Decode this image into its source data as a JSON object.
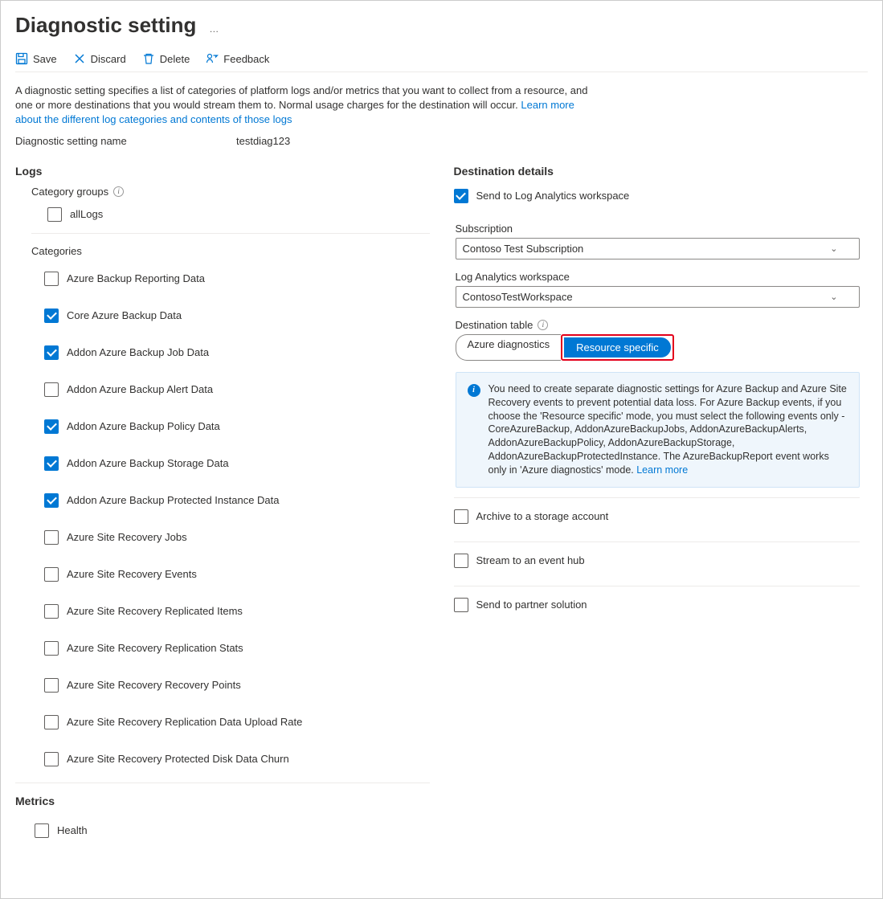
{
  "title": "Diagnostic setting",
  "ellipsis": "…",
  "toolbar": {
    "save": "Save",
    "discard": "Discard",
    "delete": "Delete",
    "feedback": "Feedback"
  },
  "description_1": "A diagnostic setting specifies a list of categories of platform logs and/or metrics that you want to collect from a resource, and one or more destinations that you would stream them to. Normal usage charges for the destination will occur. ",
  "description_link": "Learn more about the different log categories and contents of those logs",
  "name_label": "Diagnostic setting name",
  "name_value": "testdiag123",
  "logs_header": "Logs",
  "category_groups_label": "Category groups",
  "all_logs_label": "allLogs",
  "categories_label": "Categories",
  "categories": [
    {
      "label": "Azure Backup Reporting Data",
      "checked": false
    },
    {
      "label": "Core Azure Backup Data",
      "checked": true
    },
    {
      "label": "Addon Azure Backup Job Data",
      "checked": true
    },
    {
      "label": "Addon Azure Backup Alert Data",
      "checked": false
    },
    {
      "label": "Addon Azure Backup Policy Data",
      "checked": true
    },
    {
      "label": "Addon Azure Backup Storage Data",
      "checked": true
    },
    {
      "label": "Addon Azure Backup Protected Instance Data",
      "checked": true
    },
    {
      "label": "Azure Site Recovery Jobs",
      "checked": false
    },
    {
      "label": "Azure Site Recovery Events",
      "checked": false
    },
    {
      "label": "Azure Site Recovery Replicated Items",
      "checked": false
    },
    {
      "label": "Azure Site Recovery Replication Stats",
      "checked": false
    },
    {
      "label": "Azure Site Recovery Recovery Points",
      "checked": false
    },
    {
      "label": "Azure Site Recovery Replication Data Upload Rate",
      "checked": false
    },
    {
      "label": "Azure Site Recovery Protected Disk Data Churn",
      "checked": false
    }
  ],
  "metrics_header": "Metrics",
  "health_label": "Health",
  "dest_header": "Destination details",
  "dest": {
    "send_la": {
      "label": "Send to Log Analytics workspace",
      "checked": true
    },
    "subscription_label": "Subscription",
    "subscription_value": "Contoso Test Subscription",
    "workspace_label": "Log Analytics workspace",
    "workspace_value": "ContosoTestWorkspace",
    "dest_table_label": "Destination table",
    "pill_azure": "Azure diagnostics",
    "pill_resource": "Resource specific",
    "info_text": "You need to create separate diagnostic settings for Azure Backup and Azure Site Recovery events to prevent potential data loss. For Azure Backup events, if you choose the 'Resource specific' mode, you must select the following events only - CoreAzureBackup, AddonAzureBackupJobs, AddonAzureBackupAlerts, AddonAzureBackupPolicy, AddonAzureBackupStorage, AddonAzureBackupProtectedInstance. The AzureBackupReport event works only in 'Azure diagnostics' mode.  ",
    "info_link": "Learn more",
    "archive": {
      "label": "Archive to a storage account",
      "checked": false
    },
    "stream": {
      "label": "Stream to an event hub",
      "checked": false
    },
    "partner": {
      "label": "Send to partner solution",
      "checked": false
    }
  }
}
